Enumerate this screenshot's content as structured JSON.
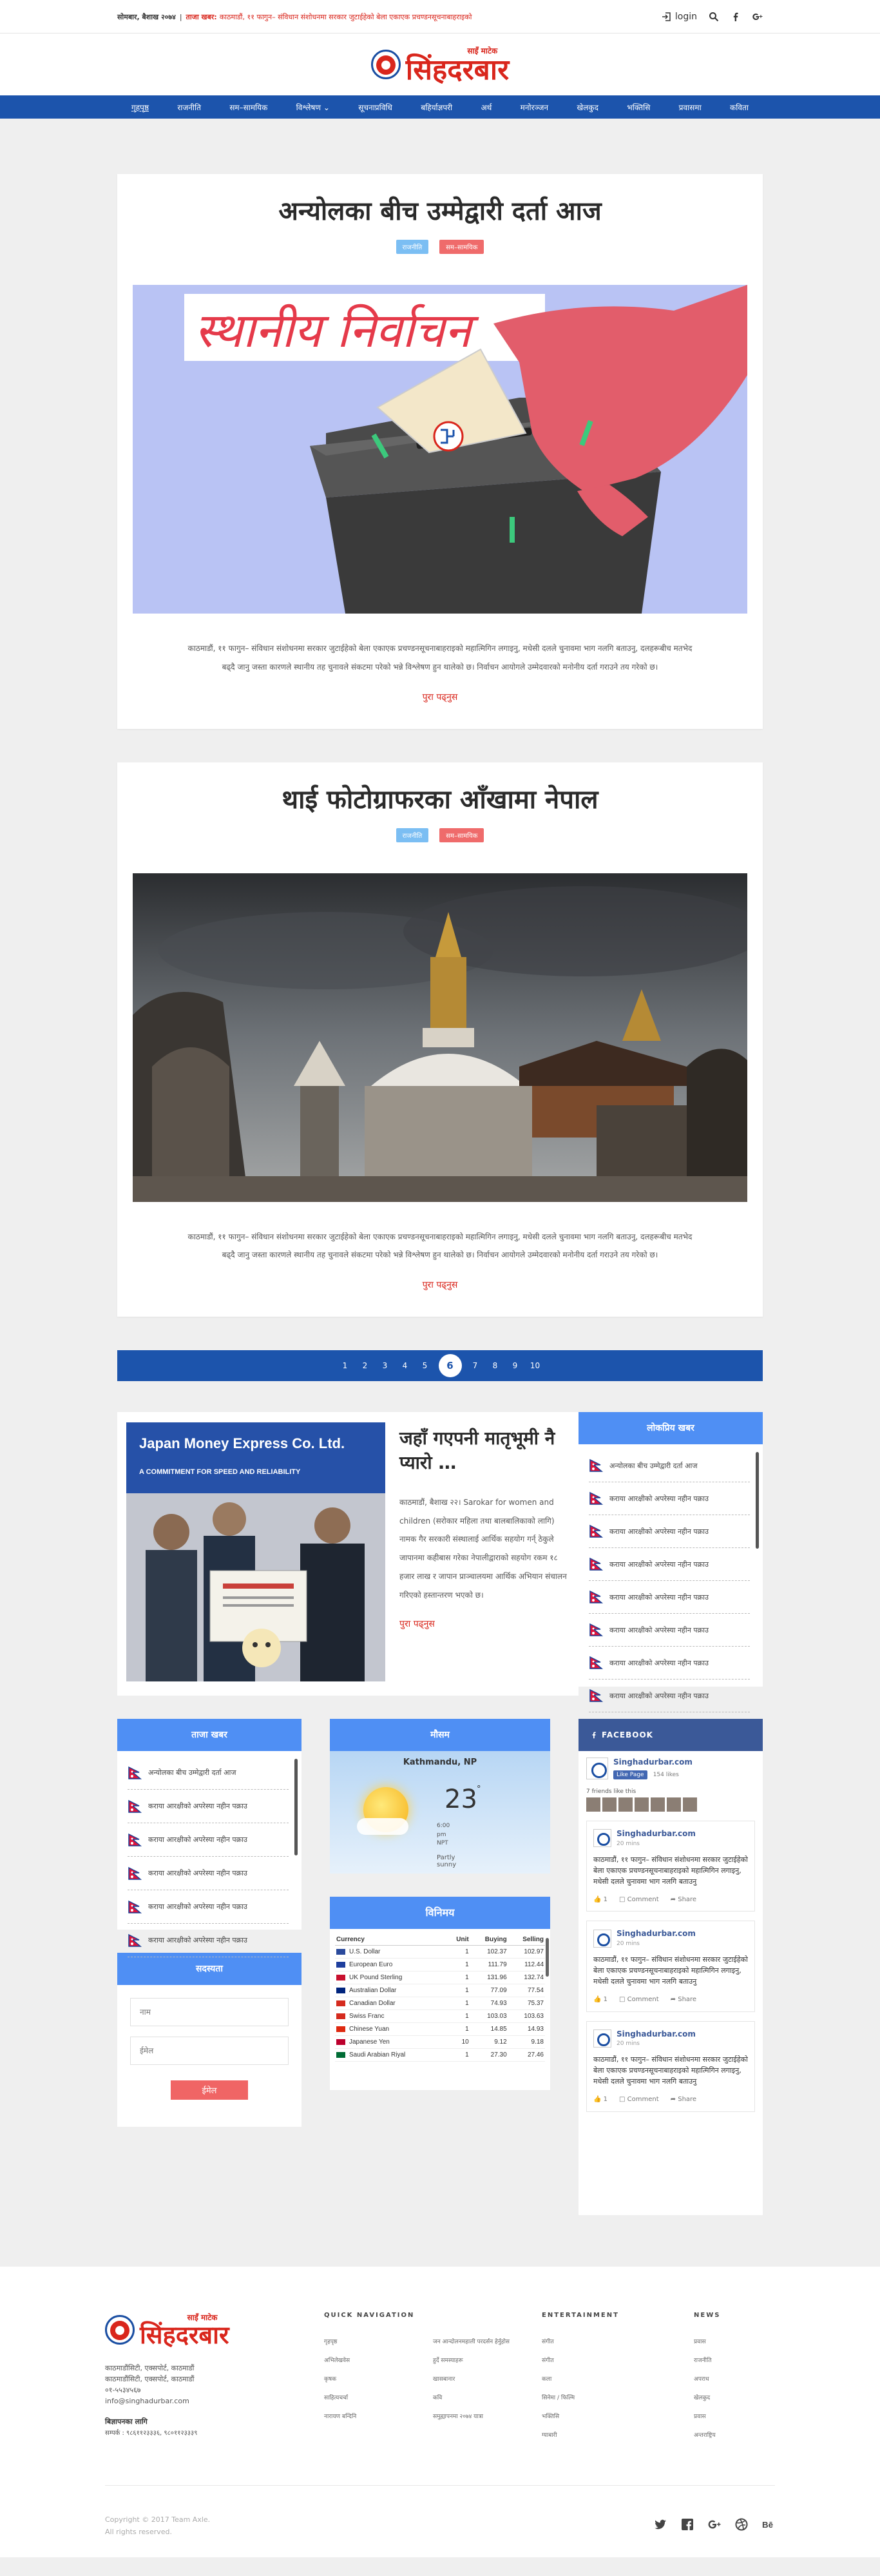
{
  "topbar": {
    "date": "सोमबार, बैशाख २०७४",
    "sep": "|",
    "ticker_label": "ताजा खबर:",
    "ticker_text": "काठमाडौं, ११ फागुन– संविधान संशोधनमा सरकार जुटाईहेको बेला एकाएक प्रचण्डनसूचनाबाहराइको",
    "login": "login"
  },
  "logo": {
    "small": "साइँ माटेक",
    "big": "सिंहदरबार"
  },
  "nav": [
    "गृहपृष्ठ",
    "राजनीति",
    "सम–सामयिक",
    "विश्लेषण",
    "सूचनाप्रविधि",
    "बहिर्याज्ञपरी",
    "अर्थ",
    "मनोरञ्जन",
    "खेलकुद",
    "भक्तिसि",
    "प्रवासमा",
    "कविता"
  ],
  "articles": [
    {
      "title": "अन्योलका बीच उम्मेद्वारी दर्ता आज",
      "tags": [
        "राजनीति",
        "सम–सामयिक"
      ],
      "image_text": "स्थानीय निर्वाचन",
      "text": "काठमाडौं, ११ फागुन– संविधान संशोधनमा सरकार जुटाईहेको बेला एकाएक प्रचण्डनसूचनाबाहराइको महात्मिगिन लगाइनु, मधेसी दलले चुनावमा भाग नलगि बताउनु, दलहरूबीच मतभेद बढ्दै जानु जस्ता कारणले स्थानीय तह चुनावले संकटमा परेको भन्ने विश्लेषण हुन थालेको छ। निर्वाचन आयोगले उम्मेदवारको मनोनीय दर्ता गराउने तय गरेको छ।",
      "readmore": "पुरा पढ्नुस"
    },
    {
      "title": "थाई फोटोग्राफरका आँखामा नेपाल",
      "tags": [
        "राजनीति",
        "सम–सामयिक"
      ],
      "image_text": "",
      "text": "काठमाडौं, ११ फागुन– संविधान संशोधनमा सरकार जुटाईहेको बेला एकाएक प्रचण्डनसूचनाबाहराइको महात्मिगिन लगाइनु, मधेसी दलले चुनावमा भाग नलगि बताउनु, दलहरूबीच मतभेद बढ्दै जानु जस्ता कारणले स्थानीय तह चुनावले संकटमा परेको भन्ने विश्लेषण हुन थालेको छ। निर्वाचन आयोगले उम्मेदवारको मनोनीय दर्ता गराउने तय गरेको छ।",
      "readmore": "पुरा पढ्नुस"
    }
  ],
  "pagination": [
    "1",
    "2",
    "3",
    "4",
    "5",
    "6",
    "7",
    "8",
    "9",
    "10"
  ],
  "pagination_current": "6",
  "feature": {
    "title": "जहाँ गएपनी मातृभूमी नै प्यारो …",
    "image_banner": "Japan Money Express Co. Ltd.",
    "image_sub": "A COMMITMENT FOR SPEED AND RELIABILITY",
    "text": "काठमाडौं, बैशाख २२। Sarokar for women and children (सरोकार महिला तथा बालबालिकाको लागि) नामक गैर सरकारी संस्थालाई आर्थिक सहयोग गर्न् ठेकुले जापानमा कहीबास गरेका नेपालीद्वाराको सहयोग रकम १८ हजार लाख र जापान प्राञ्चालयमा आर्थिक अभियान संचालन गरिएको हस्तान्तरण भएको छ।",
    "readmore": "पुरा पढ्नुस"
  },
  "popular": {
    "title": "लोकप्रिय खबर",
    "items": [
      "अन्योलका बीच उम्मेद्वारी दर्ता आज",
      "कराया आरक्षीको अपरेस्या नहीन पक्राउ",
      "कराया आरक्षीको अपरेस्या नहीन पक्राउ",
      "कराया आरक्षीको अपरेस्या नहीन पक्राउ",
      "कराया आरक्षीको अपरेस्या नहीन पक्राउ",
      "कराया आरक्षीको अपरेस्या नहीन पक्राउ",
      "कराया आरक्षीको अपरेस्या नहीन पक्राउ",
      "कराया आरक्षीको अपरेस्या नहीन पक्राउ"
    ]
  },
  "latest": {
    "title": "ताजा खबर",
    "items": [
      "अन्योलका बीच उम्मेद्वारी दर्ता आज",
      "कराया आरक्षीको अपरेस्या नहीन पक्राउ",
      "कराया आरक्षीको अपरेस्या नहीन पक्राउ",
      "कराया आरक्षीको अपरेस्या नहीन पक्राउ",
      "कराया आरक्षीको अपरेस्या नहीन पक्राउ",
      "कराया आरक्षीको अपरेस्या नहीन पक्राउ"
    ]
  },
  "subscribe": {
    "title": "सदस्यता",
    "name_placeholder": "नाम",
    "email_placeholder": "ईमेल",
    "button": "ईमेल"
  },
  "weather": {
    "title": "मौसम",
    "city": "Kathmandu, NP",
    "temp": "23",
    "unit": "°",
    "details": [
      "6:00",
      "pm",
      "NPT"
    ],
    "condition": [
      "Partly",
      "sunny"
    ]
  },
  "forex": {
    "title": "विनिमय",
    "headers": [
      "Currency",
      "Unit",
      "Buying",
      "Selling"
    ],
    "rows": [
      {
        "name": "U.S. Dollar",
        "unit": "1",
        "buy": "102.37",
        "sell": "102.97",
        "color": "#2a4a9c"
      },
      {
        "name": "European Euro",
        "unit": "1",
        "buy": "111.79",
        "sell": "112.44",
        "color": "#1e3f9e"
      },
      {
        "name": "UK Pound Sterling",
        "unit": "1",
        "buy": "131.96",
        "sell": "132.74",
        "color": "#c8102e"
      },
      {
        "name": "Australian Dollar",
        "unit": "1",
        "buy": "77.09",
        "sell": "77.54",
        "color": "#00247d"
      },
      {
        "name": "Canadian Dollar",
        "unit": "1",
        "buy": "74.93",
        "sell": "75.37",
        "color": "#d52b1e"
      },
      {
        "name": "Swiss Franc",
        "unit": "1",
        "buy": "103.03",
        "sell": "103.63",
        "color": "#d52b1e"
      },
      {
        "name": "Chinese Yuan",
        "unit": "1",
        "buy": "14.85",
        "sell": "14.93",
        "color": "#de2910"
      },
      {
        "name": "Japanese Yen",
        "unit": "10",
        "buy": "9.12",
        "sell": "9.18",
        "color": "#bc002d"
      },
      {
        "name": "Saudi Arabian Riyal",
        "unit": "1",
        "buy": "27.30",
        "sell": "27.46",
        "color": "#006c35"
      }
    ]
  },
  "facebook": {
    "title": "FACEBOOK",
    "page_name": "Singhadurbar.com",
    "like_label": "Like Page",
    "likes": "154 likes",
    "friends": "7 friends like this",
    "posts": [
      {
        "name": "Singhadurbar.com",
        "time": "20 mins",
        "text": "काठमाडौं, ११ फागुन– संविधान संशोधनमा सरकार जुटाईहेको बेला एकाएक प्रचण्डनसूचनाबाहराइको महात्मिगिन लगाइनु, मधेसी दलले चुनावमा भाग नलगि बताउनु",
        "likes": "1",
        "comment": "Comment",
        "share": "Share"
      },
      {
        "name": "Singhadurbar.com",
        "time": "20 mins",
        "text": "काठमाडौं, ११ फागुन– संविधान संशोधनमा सरकार जुटाईहेको बेला एकाएक प्रचण्डनसूचनाबाहराइको महात्मिगिन लगाइनु, मधेसी दलले चुनावमा भाग नलगि बताउनु",
        "likes": "1",
        "comment": "Comment",
        "share": "Share"
      },
      {
        "name": "Singhadurbar.com",
        "time": "20 mins",
        "text": "काठमाडौं, ११ फागुन– संविधान संशोधनमा सरकार जुटाईहेको बेला एकाएक प्रचण्डनसूचनाबाहराइको महात्मिगिन लगाइनु, मधेसी दलले चुनावमा भाग नलगि बताउनु",
        "likes": "1",
        "comment": "Comment",
        "share": "Share"
      }
    ]
  },
  "footer": {
    "address": [
      "काठमाडौंसिटी, एक्सपोर्ट, काठमाडौं",
      "काठमाडौंसिटी, एक्सपोर्ट, काठमाडौं",
      "०१-५५३४५६७",
      "info@singhadurbar.com"
    ],
    "adv_title": "बिज्ञापनका लागि",
    "adv_phone": "सम्पर्क : ९८६११२३३३६, ९८०११२३३३९",
    "quick_title": "QUICK NAVIGATION",
    "quick_links": [
      "गृहपृष्ठ",
      "जन आन्दोलनमहाली परदर्सन हेर्नुहोस",
      "अभिलेखवेस",
      "हुर्दे समस्याहरू",
      "कृषक",
      "खासबानार",
      "साहित्यचर्चा",
      "कवि",
      "नारायण बन्दिनि",
      "समुह्यापनमा २०७४ यात्रा"
    ],
    "ent_title": "ENTERTAINMENT",
    "ent_links": [
      "संगीत",
      "संगीत",
      "कला",
      "सिनेमा / फिल्मि",
      "भक्तिसि",
      "ग्याबारी"
    ],
    "news_title": "NEWS",
    "news_links": [
      "प्रवास",
      "राजनीति",
      "अपराध",
      "खेलकुद",
      "प्रवास",
      "अन्तराष्ट्रिय"
    ],
    "copyright": [
      "Copyright © 2017 Team Axle.",
      "All rights reserved."
    ]
  }
}
